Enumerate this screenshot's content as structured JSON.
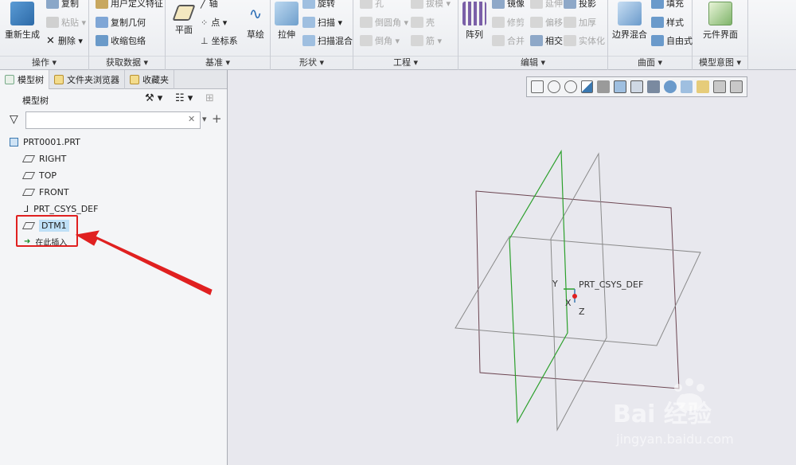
{
  "ribbon": {
    "operations": {
      "label": "操作",
      "regen": "重新生成",
      "copy": "复制",
      "paste": "粘贴",
      "delete": "删除"
    },
    "get_data": {
      "label": "获取数据",
      "udf": "用户定义特征",
      "copy_geom": "复制几何",
      "shrinkwrap": "收缩包络"
    },
    "datum": {
      "label": "基准",
      "plane": "平面",
      "axis": "轴",
      "point": "点",
      "csys": "坐标系",
      "sketch": "草绘"
    },
    "shapes": {
      "label": "形状",
      "extrude": "拉伸",
      "revolve": "旋转",
      "sweep": "扫描",
      "swept_blend": "扫描混合"
    },
    "engineering": {
      "label": "工程",
      "hole": "孔",
      "draft": "拔模",
      "round": "倒圆角",
      "shell": "壳",
      "chamfer": "倒角",
      "rib": "筋"
    },
    "editing": {
      "label": "编辑",
      "pattern": "阵列",
      "mirror": "镜像",
      "extend": "延伸",
      "project": "投影",
      "trim": "修剪",
      "offset": "偏移",
      "thicken": "加厚",
      "merge": "合并",
      "intersect": "相交",
      "solidify": "实体化"
    },
    "surfaces": {
      "label": "曲面",
      "boundary_blend": "边界混合",
      "fill": "填充",
      "style": "样式",
      "freestyle": "自由式"
    },
    "model_intent": {
      "label": "模型意图",
      "component_interface": "元件界面"
    }
  },
  "left_panel": {
    "tabs": [
      "模型树",
      "文件夹浏览器",
      "收藏夹"
    ],
    "tree_header": "模型树",
    "filter_value": "",
    "tree_items": [
      "PRT0001.PRT",
      "RIGHT",
      "TOP",
      "FRONT",
      "PRT_CSYS_DEF",
      "DTM1",
      "在此插入"
    ]
  },
  "graphics": {
    "csys_label": "PRT_CSYS_DEF",
    "axis_x": "X",
    "axis_y": "Y",
    "axis_z": "Z"
  },
  "watermark": {
    "brand": "Bai 经验",
    "url": "jingyan.baidu.com"
  },
  "colors": {
    "accent_red": "#e02020",
    "datum_green": "#2ca02c",
    "plane_brown": "#6b4450",
    "selection_blue": "#bfe0f7"
  }
}
